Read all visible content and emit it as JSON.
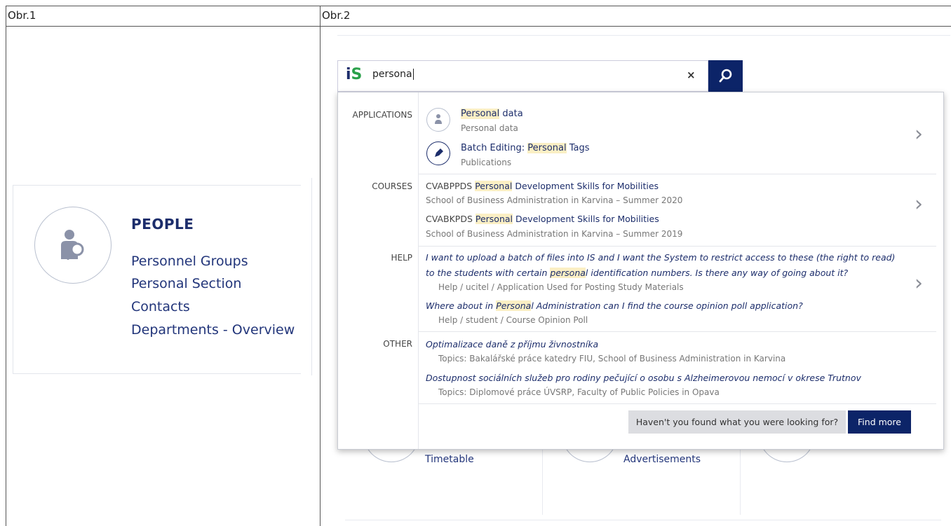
{
  "headers": {
    "left": "Obr.1",
    "right": "Obr.2"
  },
  "panel1": {
    "title": "PEOPLE",
    "links": [
      "Personnel Groups",
      "Personal Section",
      "Contacts",
      "Departments - Overview"
    ]
  },
  "search": {
    "query": "persona",
    "logo_i": "i",
    "logo_s": "S",
    "clear_glyph": "×"
  },
  "background_cards": [
    "Timetable",
    "Advertisements"
  ],
  "dropdown": {
    "applications": {
      "label": "APPLICATIONS",
      "items": [
        {
          "hl": "Personal",
          "rest": " data",
          "sub": "Personal data",
          "icon": "person-icon"
        },
        {
          "pre": "Batch Editing: ",
          "hl": "Personal",
          "rest": " Tags",
          "sub": "Publications",
          "icon": "pen-icon"
        }
      ]
    },
    "courses": {
      "label": "COURSES",
      "items": [
        {
          "code": "CVABPPDS ",
          "hl": "Personal",
          "rest": " Development Skills for Mobilities",
          "sub": "School of Business Administration in Karvina – Summer 2020"
        },
        {
          "code": "CVABKPDS ",
          "hl": "Personal",
          "rest": " Development Skills for Mobilities",
          "sub": "School of Business Administration in Karvina – Summer 2019"
        }
      ]
    },
    "help": {
      "label": "HELP",
      "items": [
        {
          "line1": "I want to upload a batch of files into IS and I want the System to restrict access to these (the right to read)",
          "line2_pre": "to the students with certain ",
          "hl": "persona",
          "line2_rest": "l identification numbers. Is there any way of going about it?",
          "sub": "Help / ucitel / Application Used for Posting Study Materials"
        },
        {
          "pre": "Where about in ",
          "hl": "Persona",
          "rest": "l Administration can I find the course opinion poll application?",
          "sub": "Help / student / Course Opinion Poll"
        }
      ]
    },
    "other": {
      "label": "OTHER",
      "items": [
        {
          "title": "Optimalizace daně z příjmu živnostníka",
          "sub": "Topics: Bakalářské práce katedry FIU, School of Business Administration in Karvina"
        },
        {
          "title": "Dostupnost sociálních služeb pro rodiny pečující o osobu s Alzheimerovou nemocí v okrese Trutnov",
          "sub": "Topics: Diplomové práce ÚVSRP, Faculty of Public Policies in Opava"
        }
      ]
    },
    "not_found_label": "Haven't you found what you were looking for?",
    "find_more_label": "Find more",
    "chevron": "›"
  },
  "colors": {
    "brand_navy": "#0c2468",
    "highlight": "#fbefc4",
    "logo_green": "#2aa04a"
  }
}
